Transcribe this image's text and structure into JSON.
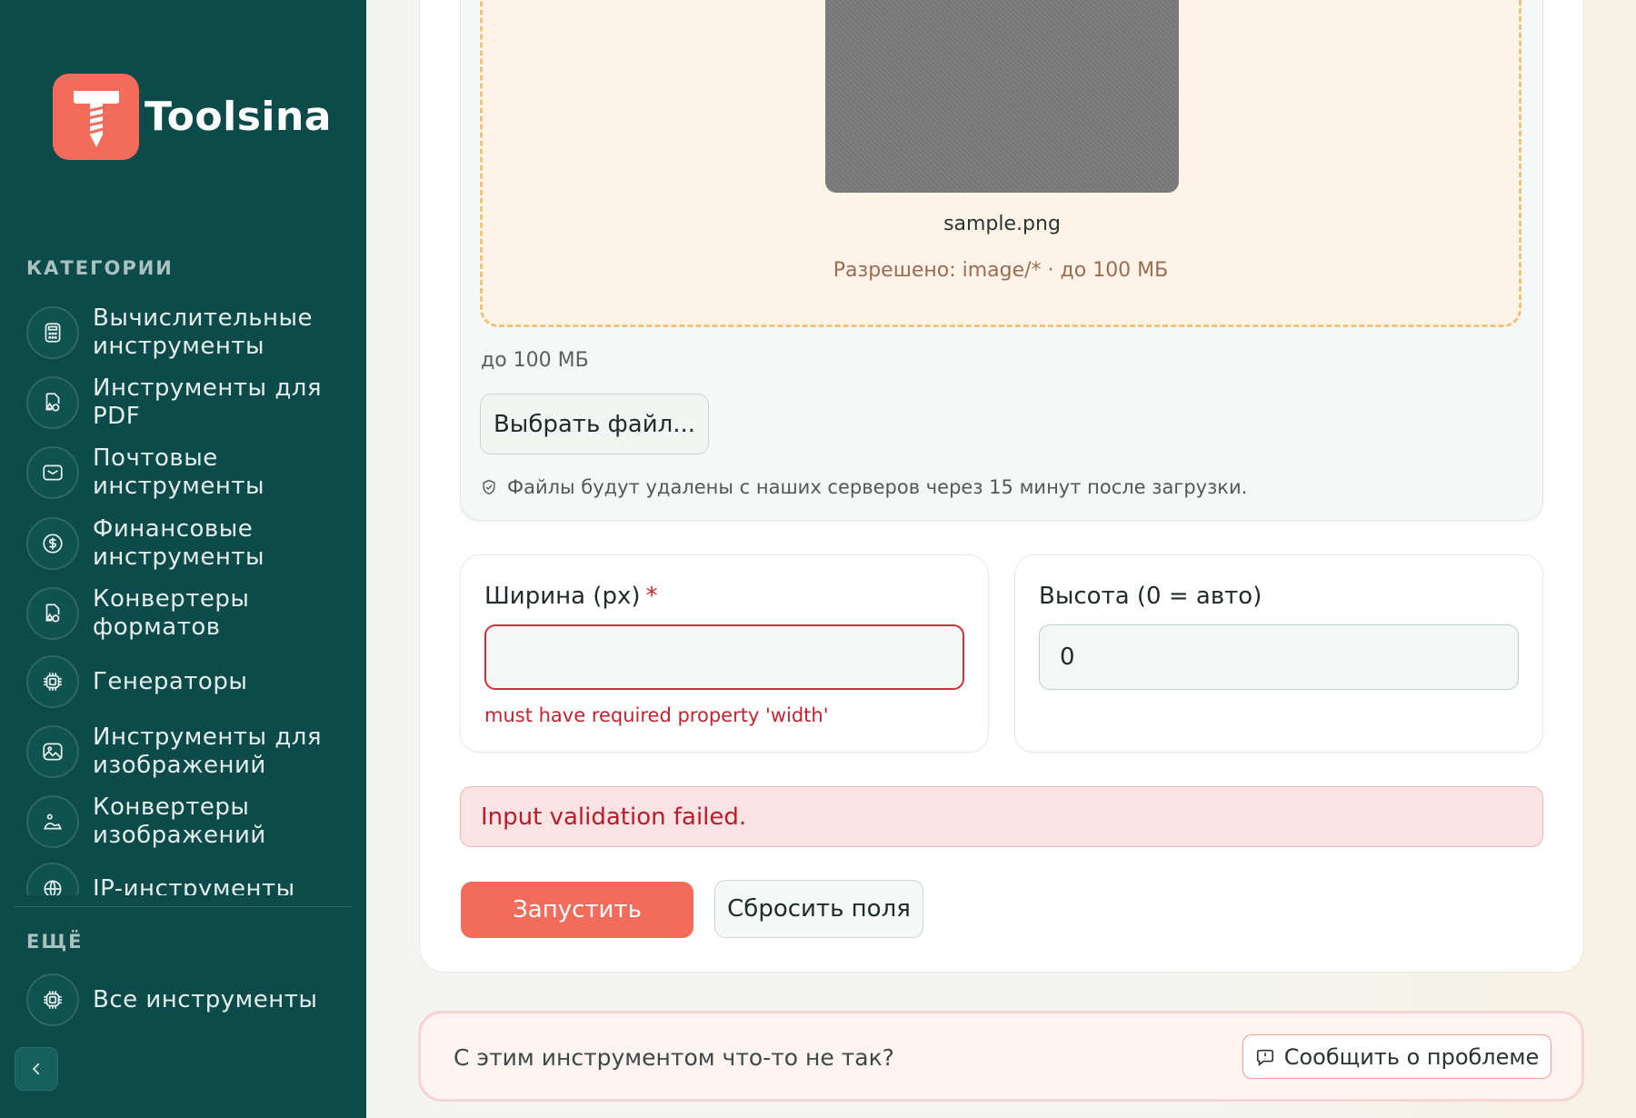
{
  "sidebar": {
    "brand": "Toolsina",
    "categories_title": "КАТЕГОРИИ",
    "categories": [
      {
        "label": "Вычислительные инструменты",
        "icon": "calculator-icon"
      },
      {
        "label": "Инструменты для PDF",
        "icon": "file-shapes-icon"
      },
      {
        "label": "Почтовые инструменты",
        "icon": "mail-icon"
      },
      {
        "label": "Финансовые инструменты",
        "icon": "dollar-icon"
      },
      {
        "label": "Конвертеры форматов",
        "icon": "file-shapes-icon"
      },
      {
        "label": "Генераторы",
        "icon": "chip-icon"
      },
      {
        "label": "Инструменты для изображений",
        "icon": "image-icon"
      },
      {
        "label": "Конвертеры изображений",
        "icon": "image-convert-icon"
      },
      {
        "label": "IP-инструменты",
        "icon": "globe-icon"
      }
    ],
    "more_title": "ЕЩЁ",
    "all_tools_label": "Все инструменты",
    "all_tools_icon": "chip-icon"
  },
  "upload": {
    "file_name": "sample.png",
    "allowed": "Разрешено: image/* · до 100 МБ",
    "limit": "до 100 МБ",
    "choose_file_label": "Выбрать файл...",
    "notice": "Файлы будут удалены с наших серверов через 15 минут после загрузки."
  },
  "fields": {
    "width": {
      "label": "Ширина (px)",
      "required_mark": "*",
      "value": "",
      "error": "must have required property 'width'"
    },
    "height": {
      "label": "Высота (0 = авто)",
      "value": "0"
    }
  },
  "alert": "Input validation failed.",
  "actions": {
    "run_label": "Запустить",
    "reset_label": "Сбросить поля"
  },
  "report": {
    "question": "С этим инструментом что-то не так?",
    "button_label": "Сообщить о проблеме"
  },
  "colors": {
    "sidebar_bg": "#0d4a4a",
    "accent": "#f26b5b",
    "error": "#c4222f",
    "dropzone_border": "#f2c27a"
  }
}
